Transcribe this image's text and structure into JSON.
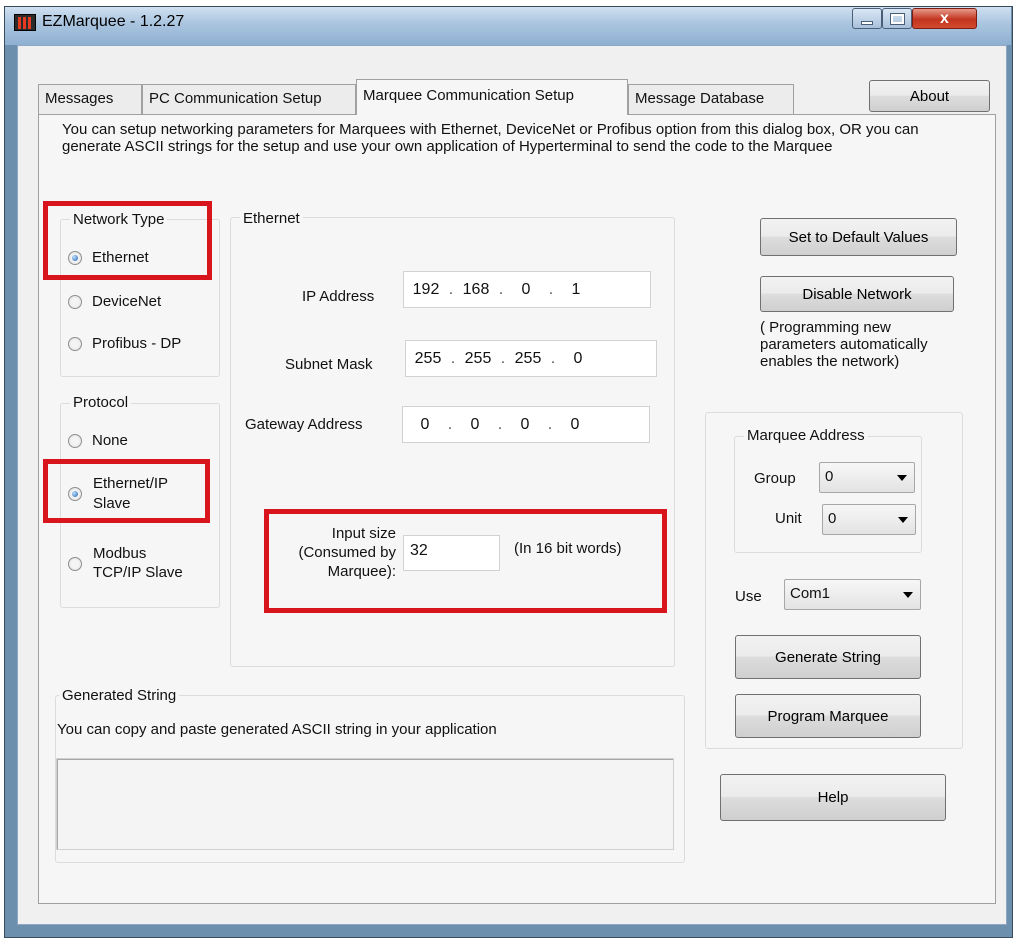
{
  "window": {
    "title": "EZMarquee - 1.2.27",
    "close_glyph": "x"
  },
  "tabs": [
    {
      "label": "Messages",
      "active": false
    },
    {
      "label": "PC Communication Setup",
      "active": false
    },
    {
      "label": "Marquee Communication Setup",
      "active": true
    },
    {
      "label": "Message Database",
      "active": false
    }
  ],
  "about_label": "About",
  "description": "You can setup networking parameters for Marquees with Ethernet, DeviceNet or Profibus option from this dialog box, OR you can generate ASCII strings for the setup and use your own application of Hyperterminal to send the code to the Marquee",
  "network_type": {
    "legend": "Network Type",
    "options": [
      "Ethernet",
      "DeviceNet",
      "Profibus - DP"
    ],
    "selected": "Ethernet"
  },
  "protocol": {
    "legend": "Protocol",
    "options": [
      {
        "line1": "None",
        "line2": ""
      },
      {
        "line1": "Ethernet/IP",
        "line2": "Slave"
      },
      {
        "line1": "Modbus",
        "line2": "TCP/IP Slave"
      }
    ],
    "selected": "Ethernet/IP Slave"
  },
  "ethernet": {
    "legend": "Ethernet",
    "ip_label": "IP Address",
    "ip": [
      "192",
      "168",
      "0",
      "1"
    ],
    "subnet_label": "Subnet Mask",
    "subnet": [
      "255",
      "255",
      "255",
      "0"
    ],
    "gateway_label": "Gateway Address",
    "gateway": [
      "0",
      "0",
      "0",
      "0"
    ],
    "input_size_label_1": "Input size",
    "input_size_label_2": "(Consumed by",
    "input_size_label_3": "Marquee):",
    "input_size_value": "32",
    "input_size_unit": "(In 16 bit words)"
  },
  "buttons": {
    "set_default": "Set to Default Values",
    "disable_network": "Disable Network",
    "generate_string": "Generate String",
    "program_marquee": "Program Marquee",
    "help": "Help"
  },
  "network_note": "( Programming new parameters automatically enables the network)",
  "marquee_address": {
    "legend": "Marquee Address",
    "group_label": "Group",
    "group_value": "0",
    "unit_label": "Unit",
    "unit_value": "0"
  },
  "use": {
    "label": "Use",
    "value": "Com1"
  },
  "generated_string": {
    "legend": "Generated String",
    "hint": "You can copy and paste generated ASCII string in your application",
    "value": ""
  },
  "colors": {
    "highlight_box": "#d8141c"
  }
}
